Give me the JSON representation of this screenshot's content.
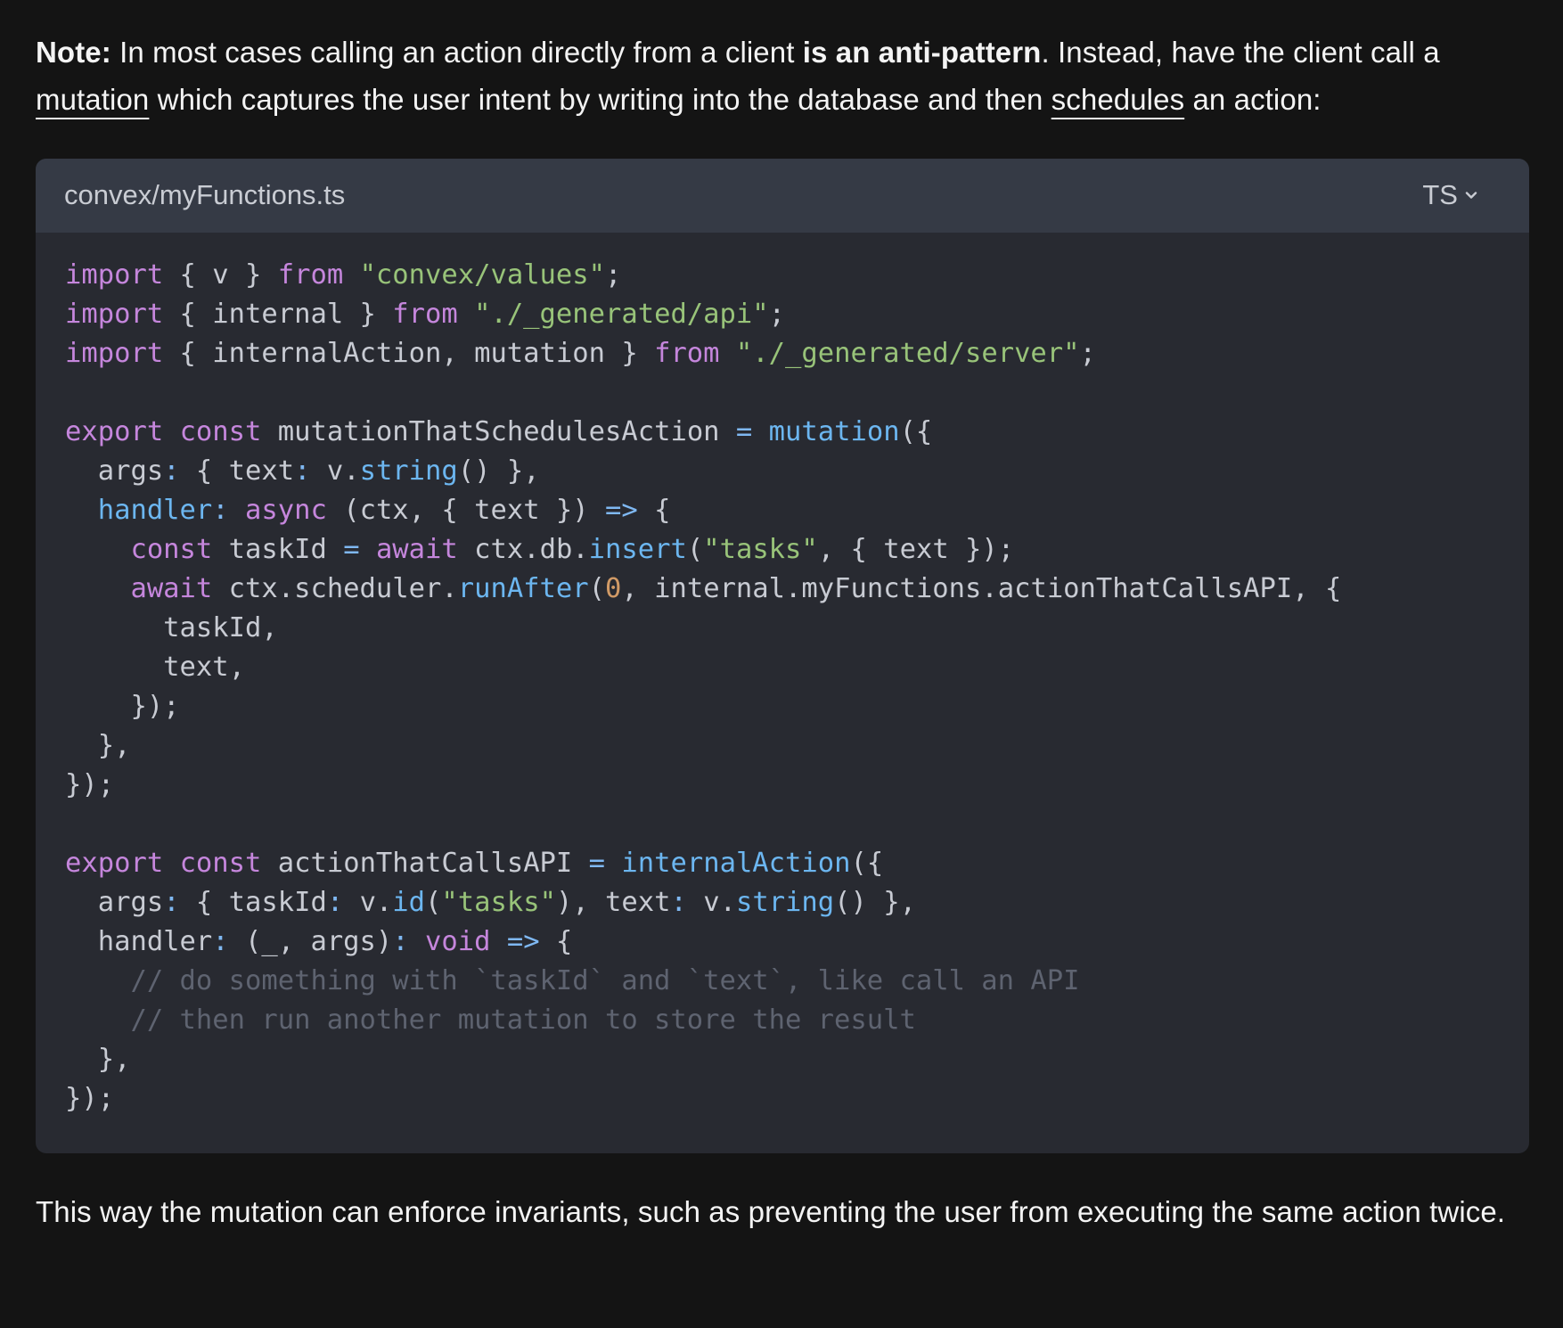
{
  "note": {
    "label": "Note:",
    "text_1": " In most cases calling an action directly from a client ",
    "bold_text": "is an anti-pattern",
    "text_2": ". Instead, have the client call a ",
    "link_mutation": "mutation",
    "text_3": " which captures the user intent by writing into the database and then ",
    "link_schedules": "schedules",
    "text_4": " an action:"
  },
  "code_block": {
    "filename": "convex/myFunctions.ts",
    "language": "TS",
    "icon": "chevron-down-icon",
    "lines": [
      [
        [
          "kw",
          "import"
        ],
        [
          "p",
          " { v } "
        ],
        [
          "kw",
          "from"
        ],
        [
          "p",
          " "
        ],
        [
          "str",
          "\"convex/values\""
        ],
        [
          "p",
          ";"
        ]
      ],
      [
        [
          "kw",
          "import"
        ],
        [
          "p",
          " { internal } "
        ],
        [
          "kw",
          "from"
        ],
        [
          "p",
          " "
        ],
        [
          "str",
          "\"./_generated/api\""
        ],
        [
          "p",
          ";"
        ]
      ],
      [
        [
          "kw",
          "import"
        ],
        [
          "p",
          " { internalAction, mutation } "
        ],
        [
          "kw",
          "from"
        ],
        [
          "p",
          " "
        ],
        [
          "str",
          "\"./_generated/server\""
        ],
        [
          "p",
          ";"
        ]
      ],
      [],
      [
        [
          "kw",
          "export"
        ],
        [
          "p",
          " "
        ],
        [
          "kw",
          "const"
        ],
        [
          "p",
          " mutationThatSchedulesAction "
        ],
        [
          "op",
          "="
        ],
        [
          "p",
          " "
        ],
        [
          "fn",
          "mutation"
        ],
        [
          "p",
          "({"
        ]
      ],
      [
        [
          "p",
          "  args"
        ],
        [
          "op",
          ":"
        ],
        [
          "p",
          " { text"
        ],
        [
          "op",
          ":"
        ],
        [
          "p",
          " v."
        ],
        [
          "fn",
          "string"
        ],
        [
          "p",
          "() },"
        ]
      ],
      [
        [
          "p",
          "  "
        ],
        [
          "fn",
          "handler"
        ],
        [
          "op",
          ":"
        ],
        [
          "p",
          " "
        ],
        [
          "kw",
          "async"
        ],
        [
          "p",
          " (ctx, { text }) "
        ],
        [
          "op",
          "=>"
        ],
        [
          "p",
          " {"
        ]
      ],
      [
        [
          "p",
          "    "
        ],
        [
          "kw",
          "const"
        ],
        [
          "p",
          " taskId "
        ],
        [
          "op",
          "="
        ],
        [
          "p",
          " "
        ],
        [
          "kw",
          "await"
        ],
        [
          "p",
          " ctx.db."
        ],
        [
          "fn",
          "insert"
        ],
        [
          "p",
          "("
        ],
        [
          "str",
          "\"tasks\""
        ],
        [
          "p",
          ", { text });"
        ]
      ],
      [
        [
          "p",
          "    "
        ],
        [
          "kw",
          "await"
        ],
        [
          "p",
          " ctx.scheduler."
        ],
        [
          "fn",
          "runAfter"
        ],
        [
          "p",
          "("
        ],
        [
          "num",
          "0"
        ],
        [
          "p",
          ", internal.myFunctions.actionThatCallsAPI, {"
        ]
      ],
      [
        [
          "p",
          "      taskId,"
        ]
      ],
      [
        [
          "p",
          "      text,"
        ]
      ],
      [
        [
          "p",
          "    });"
        ]
      ],
      [
        [
          "p",
          "  },"
        ]
      ],
      [
        [
          "p",
          "});"
        ]
      ],
      [],
      [
        [
          "kw",
          "export"
        ],
        [
          "p",
          " "
        ],
        [
          "kw",
          "const"
        ],
        [
          "p",
          " actionThatCallsAPI "
        ],
        [
          "op",
          "="
        ],
        [
          "p",
          " "
        ],
        [
          "fn",
          "internalAction"
        ],
        [
          "p",
          "({"
        ]
      ],
      [
        [
          "p",
          "  args"
        ],
        [
          "op",
          ":"
        ],
        [
          "p",
          " { taskId"
        ],
        [
          "op",
          ":"
        ],
        [
          "p",
          " v."
        ],
        [
          "fn",
          "id"
        ],
        [
          "p",
          "("
        ],
        [
          "str",
          "\"tasks\""
        ],
        [
          "p",
          "), text"
        ],
        [
          "op",
          ":"
        ],
        [
          "p",
          " v."
        ],
        [
          "fn",
          "string"
        ],
        [
          "p",
          "() },"
        ]
      ],
      [
        [
          "p",
          "  handler"
        ],
        [
          "op",
          ":"
        ],
        [
          "p",
          " (_, args)"
        ],
        [
          "op",
          ":"
        ],
        [
          "p",
          " "
        ],
        [
          "kw",
          "void"
        ],
        [
          "p",
          " "
        ],
        [
          "op",
          "=>"
        ],
        [
          "p",
          " {"
        ]
      ],
      [
        [
          "cm",
          "    // do something with `taskId` and `text`, like call an API"
        ]
      ],
      [
        [
          "cm",
          "    // then run another mutation to store the result"
        ]
      ],
      [
        [
          "p",
          "  },"
        ]
      ],
      [
        [
          "p",
          "});"
        ]
      ]
    ]
  },
  "footer_text": "This way the mutation can enforce invariants, such as preventing the user from executing the same action twice."
}
